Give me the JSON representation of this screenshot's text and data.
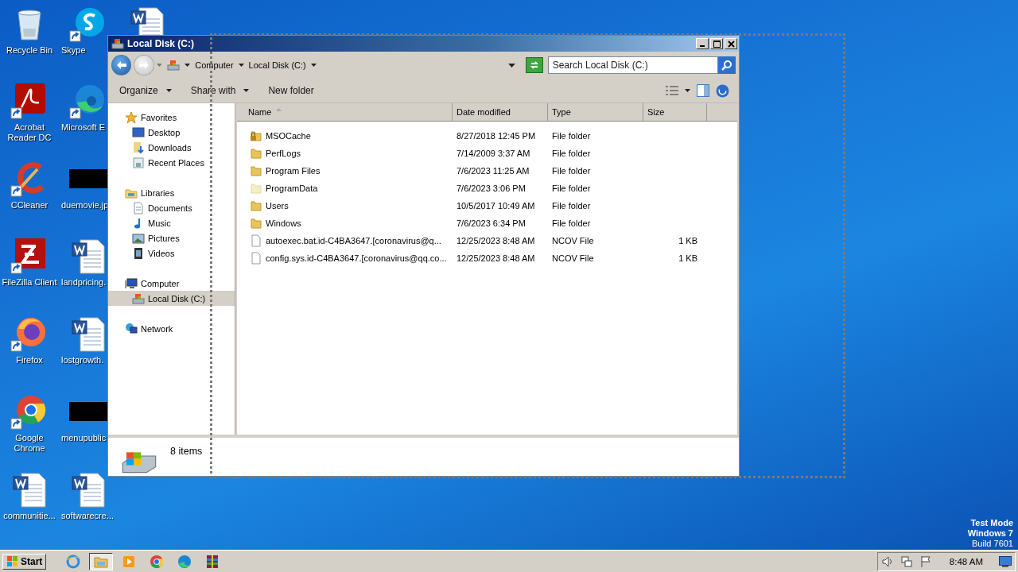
{
  "desktop_icons": [
    {
      "label": "Recycle Bin",
      "kind": "recycle",
      "shortcut": false
    },
    {
      "label": "Acrobat Reader DC",
      "kind": "acrobat",
      "shortcut": true
    },
    {
      "label": "CCleaner",
      "kind": "ccleaner",
      "shortcut": true
    },
    {
      "label": "FileZilla Client",
      "kind": "filezilla",
      "shortcut": true
    },
    {
      "label": "Firefox",
      "kind": "firefox",
      "shortcut": true
    },
    {
      "label": "Google Chrome",
      "kind": "chrome",
      "shortcut": true
    },
    {
      "label": "communitie...",
      "kind": "word",
      "shortcut": false
    },
    {
      "label": "Skype",
      "kind": "skype",
      "shortcut": true
    },
    {
      "label": "Microsoft E",
      "kind": "edge",
      "shortcut": true
    },
    {
      "label": "duemovie.jp",
      "kind": "redacted",
      "shortcut": false
    },
    {
      "label": "landpricing.",
      "kind": "word",
      "shortcut": false
    },
    {
      "label": "lostgrowth.",
      "kind": "word",
      "shortcut": false
    },
    {
      "label": "menupublic",
      "kind": "redacted",
      "shortcut": false
    },
    {
      "label": "softwarecre...",
      "kind": "word",
      "shortcut": false
    },
    {
      "kind": "word",
      "shortcut": false
    }
  ],
  "window": {
    "title": "Local Disk (C:)",
    "breadcrumb": [
      "Computer",
      "Local Disk (C:)"
    ],
    "search": {
      "placeholder": "Search Local Disk (C:)"
    },
    "toolbar": [
      {
        "label": "Organize",
        "dropdown": true
      },
      {
        "label": "Share with",
        "dropdown": true
      },
      {
        "label": "New folder",
        "dropdown": false
      }
    ],
    "nav": [
      {
        "label": "Favorites",
        "kind": "star",
        "selected": false,
        "children": [
          {
            "label": "Desktop",
            "kind": "desktop",
            "selected": false
          },
          {
            "label": "Downloads",
            "kind": "downloads",
            "selected": false
          },
          {
            "label": "Recent Places",
            "kind": "recent",
            "selected": false
          }
        ]
      },
      {
        "label": "Libraries",
        "kind": "libraries",
        "selected": false,
        "children": [
          {
            "label": "Documents",
            "kind": "documents",
            "selected": false
          },
          {
            "label": "Music",
            "kind": "music",
            "selected": false
          },
          {
            "label": "Pictures",
            "kind": "pictures",
            "selected": false
          },
          {
            "label": "Videos",
            "kind": "videos",
            "selected": false
          }
        ]
      },
      {
        "label": "Computer",
        "kind": "computer",
        "selected": false,
        "children": [
          {
            "label": "Local Disk (C:)",
            "kind": "drive",
            "selected": true
          }
        ]
      },
      {
        "label": "Network",
        "kind": "network",
        "selected": false
      }
    ],
    "columns": [
      "Name",
      "Date modified",
      "Type",
      "Size"
    ],
    "rows": [
      {
        "name": "MSOCache",
        "date": "8/27/2018 12:45 PM",
        "type": "File folder",
        "kind": "locked-folder"
      },
      {
        "name": "PerfLogs",
        "date": "7/14/2009 3:37 AM",
        "type": "File folder",
        "kind": "folder"
      },
      {
        "name": "Program Files",
        "date": "7/6/2023 11:25 AM",
        "type": "File folder",
        "kind": "folder"
      },
      {
        "name": "ProgramData",
        "date": "7/6/2023 3:06 PM",
        "type": "File folder",
        "kind": "hidden-folder"
      },
      {
        "name": "Users",
        "date": "10/5/2017 10:49 AM",
        "type": "File folder",
        "kind": "folder"
      },
      {
        "name": "Windows",
        "date": "7/6/2023 6:34 PM",
        "type": "File folder",
        "kind": "folder"
      },
      {
        "name": "autoexec.bat.id-C4BA3647.[coronavirus@q...",
        "date": "12/25/2023 8:48 AM",
        "type": "NCOV File",
        "size": "1 KB",
        "kind": "file"
      },
      {
        "name": "config.sys.id-C4BA3647.[coronavirus@qq.co...",
        "date": "12/25/2023 8:48 AM",
        "type": "NCOV File",
        "size": "1 KB",
        "kind": "file"
      }
    ],
    "status": "8 items"
  },
  "taskbar": {
    "start": "Start",
    "apps": [
      {
        "kind": "ie",
        "selected": false
      },
      {
        "kind": "explorer",
        "selected": true
      },
      {
        "kind": "media",
        "selected": false
      },
      {
        "kind": "chrome",
        "selected": false
      },
      {
        "kind": "edge",
        "selected": false
      },
      {
        "kind": "winrar",
        "selected": false
      }
    ],
    "clock": "8:48 AM"
  },
  "os_notice": [
    "Test Mode",
    "Windows 7",
    "Build 7601"
  ]
}
